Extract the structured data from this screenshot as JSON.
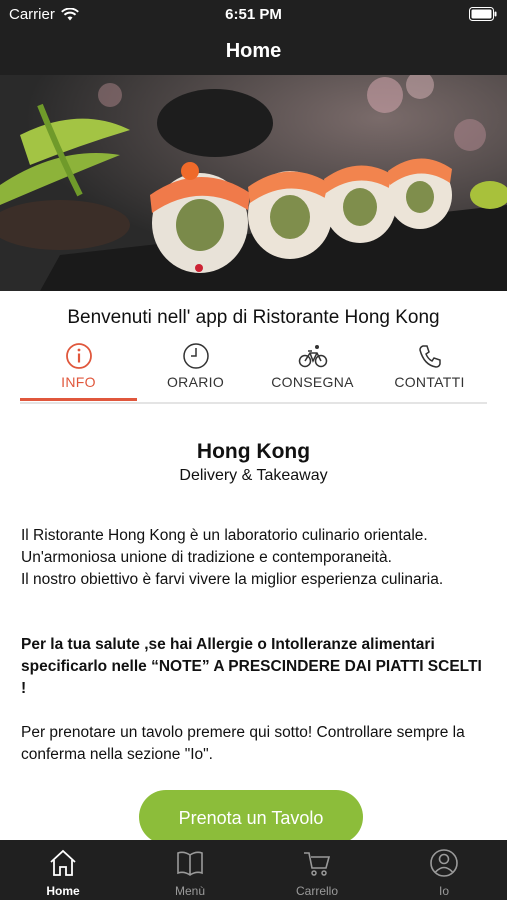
{
  "status_bar": {
    "carrier": "Carrier",
    "time": "6:51 PM"
  },
  "nav": {
    "title": "Home"
  },
  "welcome": "Benvenuti nell' app di Ristorante Hong Kong",
  "tabs": [
    {
      "label": "INFO",
      "icon": "info-icon"
    },
    {
      "label": "ORARIO",
      "icon": "clock-icon"
    },
    {
      "label": "CONSEGNA",
      "icon": "bicycle-icon"
    },
    {
      "label": "CONTATTI",
      "icon": "phone-icon"
    }
  ],
  "info": {
    "title": "Hong Kong",
    "subtitle": "Delivery & Takeaway",
    "paragraph1": "Il Ristorante Hong Kong è un laboratorio culinario orientale. Un'armoniosa unione di tradizione e contemporaneità.\nIl nostro obiettivo è farvi vivere la miglior esperienza culinaria.",
    "paragraph2": "Per la tua salute ,se hai Allergie o Intolleranze alimentari specificarlo nelle “NOTE” A PRESCINDERE DAI PIATTI SCELTI !",
    "paragraph3": "Per prenotare un tavolo premere qui sotto! Controllare sempre la conferma nella sezione \"Io\"."
  },
  "cta": {
    "label": "Prenota un Tavolo"
  },
  "tabbar": [
    {
      "label": "Home",
      "icon": "home-icon"
    },
    {
      "label": "Menù",
      "icon": "book-icon"
    },
    {
      "label": "Carrello",
      "icon": "cart-icon"
    },
    {
      "label": "Io",
      "icon": "user-icon"
    }
  ],
  "colors": {
    "accent": "#e0573c",
    "cta": "#8cbd3a",
    "bar_background": "#202020"
  }
}
